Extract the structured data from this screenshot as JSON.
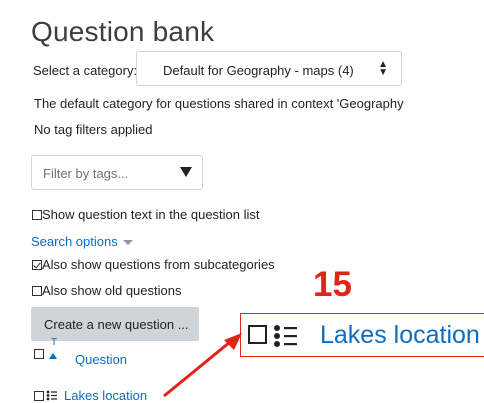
{
  "page_title": "Question bank",
  "category": {
    "label": "Select a category:",
    "selected": "Default for Geography - maps (4)"
  },
  "context_info": "The default category for questions shared in context 'Geography",
  "tag_filter_status": "No tag filters applied",
  "tag_filter": {
    "placeholder": "Filter by tags..."
  },
  "options": {
    "show_question_text": {
      "label": "Show question text in the question list",
      "checked": false
    },
    "search_options": {
      "label": "Search options"
    },
    "subcategories": {
      "label": "Also show questions from subcategories",
      "checked": true
    },
    "old_questions": {
      "label": "Also show old questions",
      "checked": false
    }
  },
  "create_button": {
    "label": "Create a new question ..."
  },
  "table": {
    "header": {
      "sort_indicator": "T",
      "column_label": "Question"
    },
    "rows": [
      {
        "name": "Lakes location",
        "icon": "multichoice-list-icon",
        "checked": false
      }
    ]
  },
  "annotation": {
    "step_number": "15",
    "zoom_label": "Lakes location",
    "color": "#e2231a"
  },
  "colors": {
    "link": "#0f6cbf",
    "button_bg": "#ced4da",
    "text": "#1d2125"
  }
}
